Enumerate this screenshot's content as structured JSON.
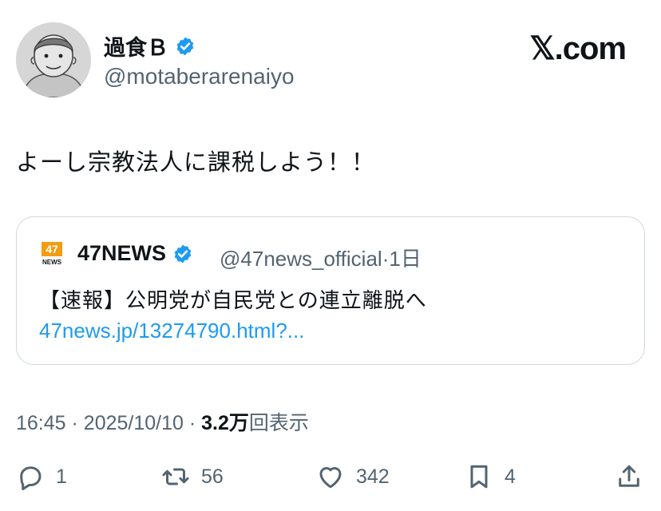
{
  "author": {
    "display_name": "過食Ｂ",
    "handle": "@motaberarenaiyo",
    "avatar_icon": "avatar-illustration",
    "verified_icon": "verified-badge-icon"
  },
  "brand": {
    "label": "𝕏.com"
  },
  "tweet": {
    "text": "よーし宗教法人に課税しよう！！"
  },
  "quote": {
    "logo_text": "47 NEWS",
    "name": "47NEWS",
    "handle": "@47news_official",
    "separator": "·",
    "time": "1日",
    "text": "【速報】公明党が自民党との連立離脱へ",
    "link": "47news.jp/13274790.html?..."
  },
  "meta": {
    "time": "16:45",
    "sep1": "·",
    "date": "2025/10/10",
    "sep2": "·",
    "views_count": "3.2万",
    "views_label": "回表示"
  },
  "actions": {
    "reply_count": "1",
    "repost_count": "56",
    "like_count": "342",
    "bookmark_count": "4"
  },
  "colors": {
    "text": "#0f1419",
    "secondary": "#536471",
    "link": "#1d9bf0",
    "verified": "#1d9bf0",
    "border": "#cfd9de"
  }
}
